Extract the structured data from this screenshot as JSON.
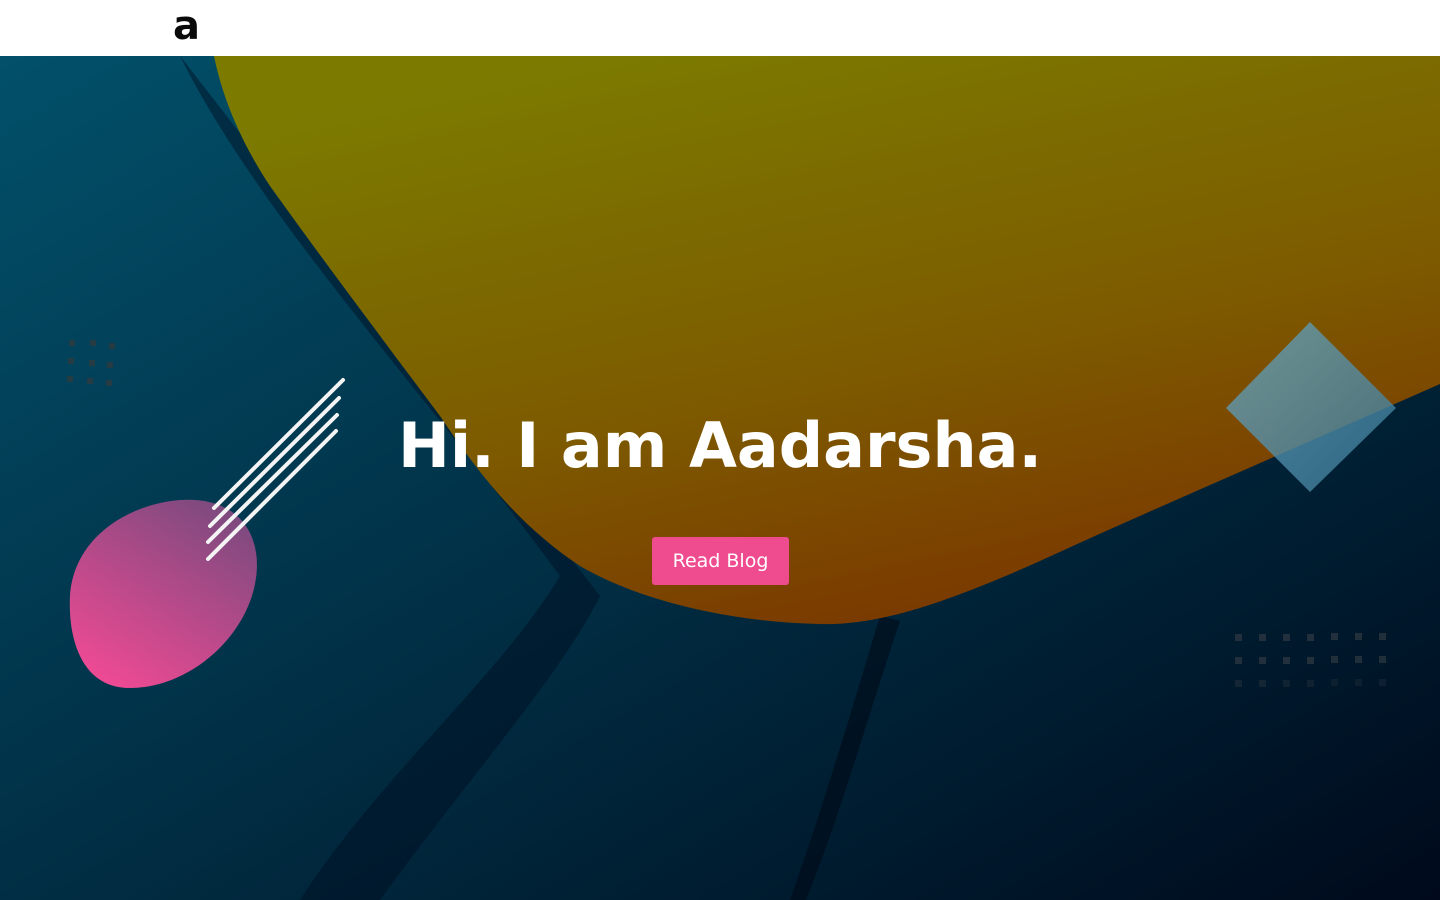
{
  "header": {
    "logo_text": "a"
  },
  "hero": {
    "title": "Hi. I am Aadarsha.",
    "cta_label": "Read Blog"
  },
  "colors": {
    "accent_pink": "#ef4b8f",
    "background_dark": "#02213a",
    "blob_olive": "#7c7a00",
    "blob_orange": "#7a3a00",
    "diamond_blue": "#5b9ab6"
  },
  "decorations": {
    "left_blob": "pink-blob",
    "stripes": "white-stripes",
    "diamond": "blue-diamond",
    "dots_left": "dot-grid",
    "dots_right": "dot-grid"
  }
}
